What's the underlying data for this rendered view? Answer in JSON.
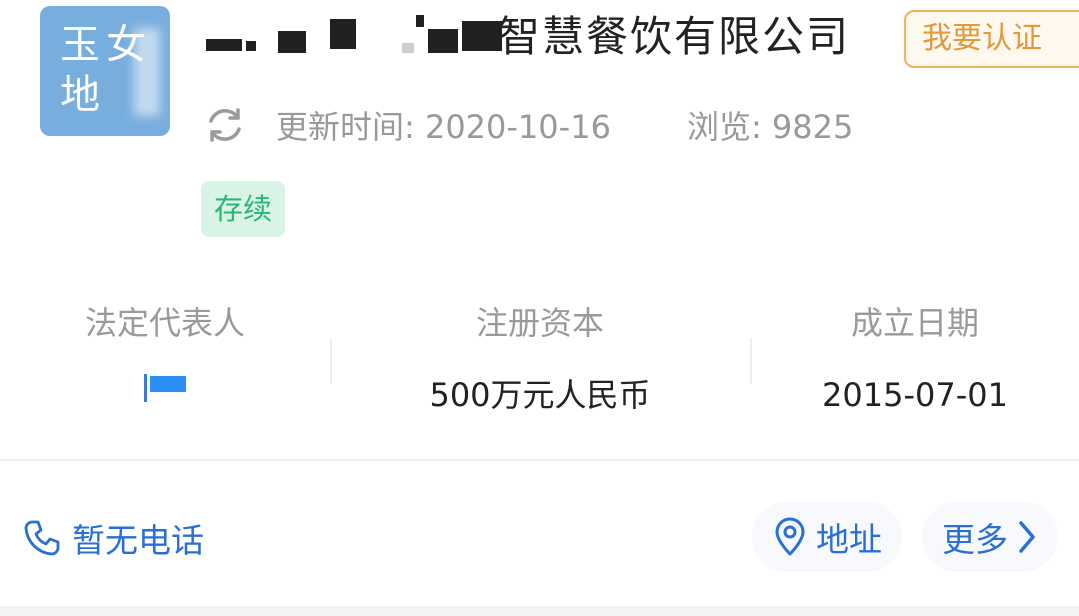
{
  "header": {
    "logo_text": "玉女地",
    "company_name_visible": "智慧餐饮有限公司",
    "certify_label": "我要认证",
    "update_label": "更新时间: 2020-10-16",
    "views_label": "浏览: 9825",
    "status": "存续"
  },
  "info": {
    "legal_rep_label": "法定代表人",
    "capital_label": "注册资本",
    "capital_value": "500万元人民币",
    "founded_label": "成立日期",
    "founded_value": "2015-07-01"
  },
  "actions": {
    "phone_label": "暂无电话",
    "address_label": "地址",
    "more_label": "更多"
  },
  "colors": {
    "accent_blue": "#2a6fd6",
    "status_green": "#2bb673",
    "certify_orange": "#e09a3a",
    "logo_blue": "#78aede"
  },
  "icons": {
    "refresh": "refresh-icon",
    "phone": "phone-icon",
    "address": "location-pin-icon",
    "more": "chevron-right-icon"
  }
}
